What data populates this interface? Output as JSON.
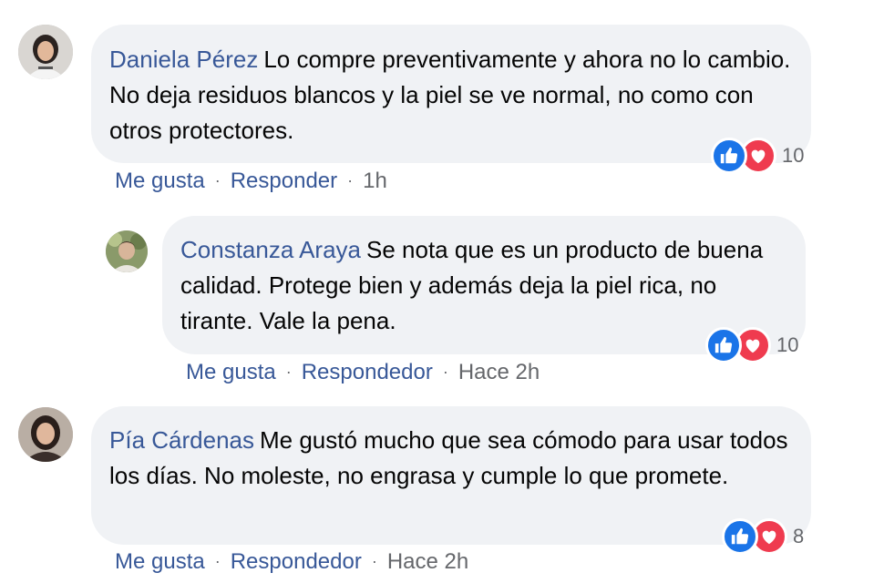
{
  "comments": [
    {
      "author": "Daniela Pérez",
      "text": "Lo compre preventivamente y ahora no lo cambio. No deja residuos blancos y la piel se ve normal, no como con otros protectores.",
      "like_label": "Me gusta",
      "reply_label": "Responder",
      "time": "1h",
      "reaction_count": "10",
      "reactions": [
        "like-icon",
        "love-icon"
      ]
    },
    {
      "author": "Constanza Araya",
      "text": "Se nota que es un producto de buena calidad. Protege bien y además deja la piel rica, no tirante. Vale la pena.",
      "like_label": "Me gusta",
      "reply_label": "Respondedor",
      "time": "Hace 2h",
      "reaction_count": "10",
      "reactions": [
        "like-icon",
        "love-icon"
      ]
    },
    {
      "author": "Pía Cárdenas",
      "text": "Me gustó mucho que sea cómodo para usar todos los días. No moleste, no engrasa y cumple lo que promete.",
      "like_label": "Me gusta",
      "reply_label": "Respondedor",
      "time": "Hace 2h",
      "reaction_count": "8",
      "reactions": [
        "like-icon",
        "love-icon"
      ]
    }
  ],
  "separator": "·",
  "colors": {
    "bubble": "#f0f2f5",
    "author": "#385898",
    "meta": "#65676b",
    "like": "#1a74e8",
    "love": "#ef3b4f"
  }
}
